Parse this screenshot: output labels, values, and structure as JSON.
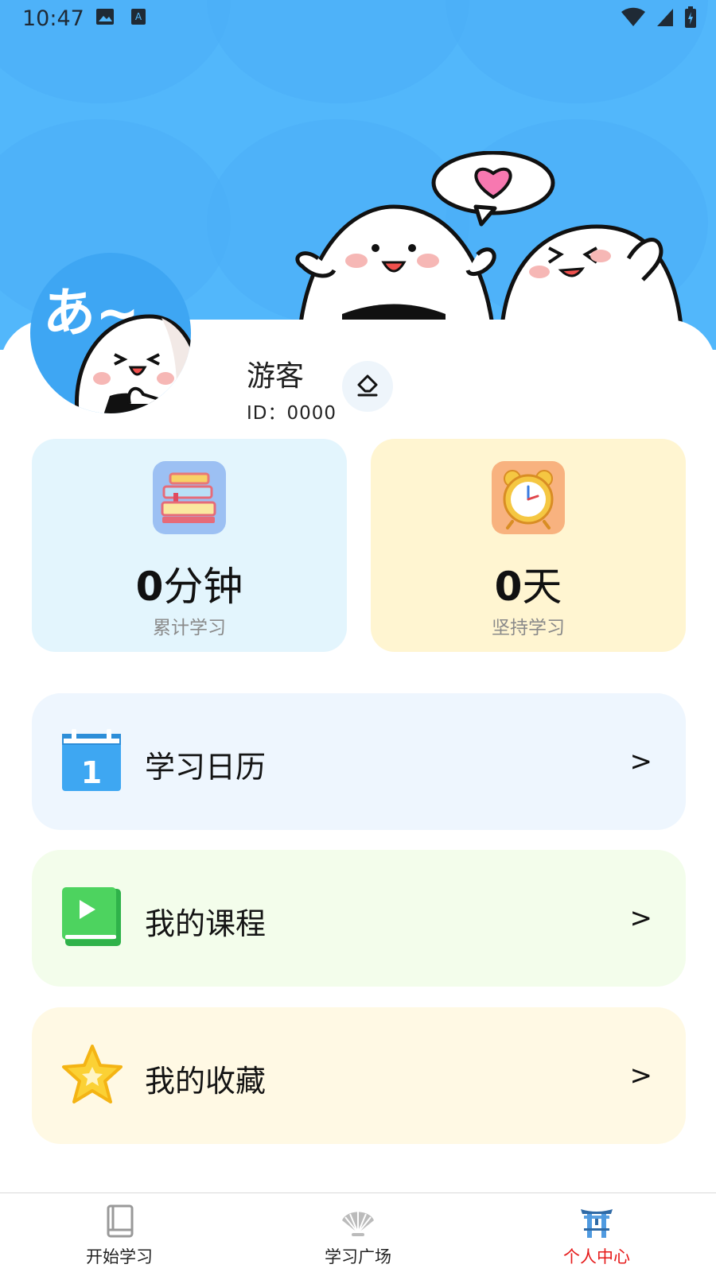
{
  "status_bar": {
    "time": "10:47"
  },
  "header": {
    "avatar_text": "あ~"
  },
  "profile": {
    "name": "游客",
    "id_text": "ID：0000"
  },
  "stats": [
    {
      "value": "0",
      "unit": "分钟",
      "label": "累计学习",
      "icon": "books-icon"
    },
    {
      "value": "0",
      "unit": "天",
      "label": "坚持学习",
      "icon": "alarm-clock-icon"
    }
  ],
  "menu": [
    {
      "label": "学习日历",
      "icon": "calendar-icon",
      "chevron": ">"
    },
    {
      "label": "我的课程",
      "icon": "course-book-icon",
      "chevron": ">"
    },
    {
      "label": "我的收藏",
      "icon": "star-icon",
      "chevron": ">"
    }
  ],
  "bottom_nav": {
    "items": [
      {
        "label": "开始学习",
        "icon": "book-icon",
        "active": false
      },
      {
        "label": "学习广场",
        "icon": "fan-icon",
        "active": false
      },
      {
        "label": "个人中心",
        "icon": "torii-icon",
        "active": true
      }
    ],
    "active_color": "#e61b1b"
  },
  "colors": {
    "header_blue": "#52b7fb",
    "study_card": "#e3f5fd",
    "streak_card": "#fff5d1",
    "calendar_bg": "#eef6fe",
    "courses_bg": "#f3fdeb",
    "favorites_bg": "#fff9e4"
  }
}
